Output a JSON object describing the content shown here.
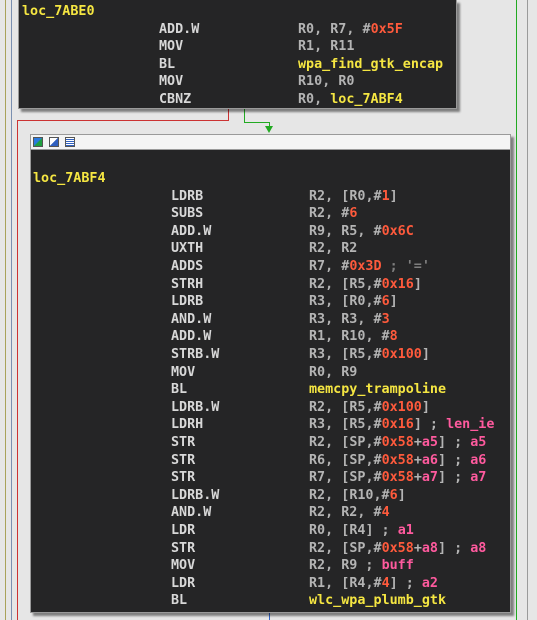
{
  "colors": {
    "background": "#e6e6e6",
    "node_bg": "#252526",
    "label": "#f5e642",
    "mnemonic": "#d8d8d8",
    "register": "#b4b4b4",
    "number": "#ff5a3c",
    "comment": "#7f7f7f",
    "variable": "#ff5a9e",
    "edge_true": "#22aa22",
    "edge_false": "#cc3333",
    "edge_normal": "#3366cc"
  },
  "node_a": {
    "label": "loc_7ABE0",
    "lines": [
      {
        "mn": "ADD.W",
        "ops": [
          {
            "t": "R0",
            "c": "reg"
          },
          {
            "t": ", ",
            "c": "plain"
          },
          {
            "t": "R7",
            "c": "reg"
          },
          {
            "t": ", #",
            "c": "plain"
          },
          {
            "t": "0x5F",
            "c": "num"
          }
        ]
      },
      {
        "mn": "MOV",
        "ops": [
          {
            "t": "R1",
            "c": "reg"
          },
          {
            "t": ", ",
            "c": "plain"
          },
          {
            "t": "R11",
            "c": "reg"
          }
        ]
      },
      {
        "mn": "BL",
        "ops": [
          {
            "t": "wpa_find_gtk_encap",
            "c": "sym"
          }
        ]
      },
      {
        "mn": "MOV",
        "ops": [
          {
            "t": "R10",
            "c": "reg"
          },
          {
            "t": ", ",
            "c": "plain"
          },
          {
            "t": "R0",
            "c": "reg"
          }
        ]
      },
      {
        "mn": "CBNZ",
        "ops": [
          {
            "t": "R0",
            "c": "reg"
          },
          {
            "t": ", ",
            "c": "plain"
          },
          {
            "t": "loc_7ABF4",
            "c": "sym"
          }
        ]
      }
    ]
  },
  "node_b": {
    "titlebar_icons": [
      "graph-color-icon",
      "graph-edit-icon",
      "graph-list-icon"
    ],
    "label": "loc_7ABF4",
    "lines": [
      {
        "mn": "LDRB",
        "ops": [
          {
            "t": "R2",
            "c": "reg"
          },
          {
            "t": ", [",
            "c": "plain"
          },
          {
            "t": "R0",
            "c": "reg"
          },
          {
            "t": ",#",
            "c": "plain"
          },
          {
            "t": "1",
            "c": "num"
          },
          {
            "t": "]",
            "c": "plain"
          }
        ]
      },
      {
        "mn": "SUBS",
        "ops": [
          {
            "t": "R2",
            "c": "reg"
          },
          {
            "t": ", #",
            "c": "plain"
          },
          {
            "t": "6",
            "c": "num"
          }
        ]
      },
      {
        "mn": "ADD.W",
        "ops": [
          {
            "t": "R9",
            "c": "reg"
          },
          {
            "t": ", ",
            "c": "plain"
          },
          {
            "t": "R5",
            "c": "reg"
          },
          {
            "t": ", #",
            "c": "plain"
          },
          {
            "t": "0x6C",
            "c": "num"
          }
        ]
      },
      {
        "mn": "UXTH",
        "ops": [
          {
            "t": "R2",
            "c": "reg"
          },
          {
            "t": ", ",
            "c": "plain"
          },
          {
            "t": "R2",
            "c": "reg"
          }
        ]
      },
      {
        "mn": "ADDS",
        "ops": [
          {
            "t": "R7",
            "c": "reg"
          },
          {
            "t": ", #",
            "c": "plain"
          },
          {
            "t": "0x3D",
            "c": "num"
          },
          {
            "t": " ; '='",
            "c": "cmt"
          }
        ]
      },
      {
        "mn": "STRH",
        "ops": [
          {
            "t": "R2",
            "c": "reg"
          },
          {
            "t": ", [",
            "c": "plain"
          },
          {
            "t": "R5",
            "c": "reg"
          },
          {
            "t": ",#",
            "c": "plain"
          },
          {
            "t": "0x16",
            "c": "num"
          },
          {
            "t": "]",
            "c": "plain"
          }
        ]
      },
      {
        "mn": "LDRB",
        "ops": [
          {
            "t": "R3",
            "c": "reg"
          },
          {
            "t": ", [",
            "c": "plain"
          },
          {
            "t": "R0",
            "c": "reg"
          },
          {
            "t": ",#",
            "c": "plain"
          },
          {
            "t": "6",
            "c": "num"
          },
          {
            "t": "]",
            "c": "plain"
          }
        ]
      },
      {
        "mn": "AND.W",
        "ops": [
          {
            "t": "R3",
            "c": "reg"
          },
          {
            "t": ", ",
            "c": "plain"
          },
          {
            "t": "R3",
            "c": "reg"
          },
          {
            "t": ", #",
            "c": "plain"
          },
          {
            "t": "3",
            "c": "num"
          }
        ]
      },
      {
        "mn": "ADD.W",
        "ops": [
          {
            "t": "R1",
            "c": "reg"
          },
          {
            "t": ", ",
            "c": "plain"
          },
          {
            "t": "R10",
            "c": "reg"
          },
          {
            "t": ", #",
            "c": "plain"
          },
          {
            "t": "8",
            "c": "num"
          }
        ]
      },
      {
        "mn": "STRB.W",
        "ops": [
          {
            "t": "R3",
            "c": "reg"
          },
          {
            "t": ", [",
            "c": "plain"
          },
          {
            "t": "R5",
            "c": "reg"
          },
          {
            "t": ",#",
            "c": "plain"
          },
          {
            "t": "0x100",
            "c": "num"
          },
          {
            "t": "]",
            "c": "plain"
          }
        ]
      },
      {
        "mn": "MOV",
        "ops": [
          {
            "t": "R0",
            "c": "reg"
          },
          {
            "t": ", ",
            "c": "plain"
          },
          {
            "t": "R9",
            "c": "reg"
          }
        ]
      },
      {
        "mn": "BL",
        "ops": [
          {
            "t": "memcpy_trampoline",
            "c": "sym"
          }
        ]
      },
      {
        "mn": "LDRB.W",
        "ops": [
          {
            "t": "R2",
            "c": "reg"
          },
          {
            "t": ", [",
            "c": "plain"
          },
          {
            "t": "R5",
            "c": "reg"
          },
          {
            "t": ",#",
            "c": "plain"
          },
          {
            "t": "0x100",
            "c": "num"
          },
          {
            "t": "]",
            "c": "plain"
          }
        ]
      },
      {
        "mn": "LDRH",
        "ops": [
          {
            "t": "R3",
            "c": "reg"
          },
          {
            "t": ", [",
            "c": "plain"
          },
          {
            "t": "R5",
            "c": "reg"
          },
          {
            "t": ",#",
            "c": "plain"
          },
          {
            "t": "0x16",
            "c": "num"
          },
          {
            "t": "] ; ",
            "c": "plain"
          },
          {
            "t": "len_ie",
            "c": "var"
          }
        ]
      },
      {
        "mn": "STR",
        "ops": [
          {
            "t": "R2",
            "c": "reg"
          },
          {
            "t": ", [",
            "c": "plain"
          },
          {
            "t": "SP",
            "c": "reg"
          },
          {
            "t": ",#",
            "c": "plain"
          },
          {
            "t": "0x58",
            "c": "num"
          },
          {
            "t": "+",
            "c": "plain"
          },
          {
            "t": "a5",
            "c": "var"
          },
          {
            "t": "] ; ",
            "c": "plain"
          },
          {
            "t": "a5",
            "c": "var"
          }
        ]
      },
      {
        "mn": "STR",
        "ops": [
          {
            "t": "R6",
            "c": "reg"
          },
          {
            "t": ", [",
            "c": "plain"
          },
          {
            "t": "SP",
            "c": "reg"
          },
          {
            "t": ",#",
            "c": "plain"
          },
          {
            "t": "0x58",
            "c": "num"
          },
          {
            "t": "+",
            "c": "plain"
          },
          {
            "t": "a6",
            "c": "var"
          },
          {
            "t": "] ; ",
            "c": "plain"
          },
          {
            "t": "a6",
            "c": "var"
          }
        ]
      },
      {
        "mn": "STR",
        "ops": [
          {
            "t": "R7",
            "c": "reg"
          },
          {
            "t": ", [",
            "c": "plain"
          },
          {
            "t": "SP",
            "c": "reg"
          },
          {
            "t": ",#",
            "c": "plain"
          },
          {
            "t": "0x58",
            "c": "num"
          },
          {
            "t": "+",
            "c": "plain"
          },
          {
            "t": "a7",
            "c": "var"
          },
          {
            "t": "] ; ",
            "c": "plain"
          },
          {
            "t": "a7",
            "c": "var"
          }
        ]
      },
      {
        "mn": "LDRB.W",
        "ops": [
          {
            "t": "R2",
            "c": "reg"
          },
          {
            "t": ", [",
            "c": "plain"
          },
          {
            "t": "R10",
            "c": "reg"
          },
          {
            "t": ",#",
            "c": "plain"
          },
          {
            "t": "6",
            "c": "num"
          },
          {
            "t": "]",
            "c": "plain"
          }
        ]
      },
      {
        "mn": "AND.W",
        "ops": [
          {
            "t": "R2",
            "c": "reg"
          },
          {
            "t": ", ",
            "c": "plain"
          },
          {
            "t": "R2",
            "c": "reg"
          },
          {
            "t": ", #",
            "c": "plain"
          },
          {
            "t": "4",
            "c": "num"
          }
        ]
      },
      {
        "mn": "LDR",
        "ops": [
          {
            "t": "R0",
            "c": "reg"
          },
          {
            "t": ", [",
            "c": "plain"
          },
          {
            "t": "R4",
            "c": "reg"
          },
          {
            "t": "] ; ",
            "c": "plain"
          },
          {
            "t": "a1",
            "c": "var"
          }
        ]
      },
      {
        "mn": "STR",
        "ops": [
          {
            "t": "R2",
            "c": "reg"
          },
          {
            "t": ", [",
            "c": "plain"
          },
          {
            "t": "SP",
            "c": "reg"
          },
          {
            "t": ",#",
            "c": "plain"
          },
          {
            "t": "0x58",
            "c": "num"
          },
          {
            "t": "+",
            "c": "plain"
          },
          {
            "t": "a8",
            "c": "var"
          },
          {
            "t": "] ; ",
            "c": "plain"
          },
          {
            "t": "a8",
            "c": "var"
          }
        ]
      },
      {
        "mn": "MOV",
        "ops": [
          {
            "t": "R2",
            "c": "reg"
          },
          {
            "t": ", ",
            "c": "plain"
          },
          {
            "t": "R9",
            "c": "reg"
          },
          {
            "t": " ; ",
            "c": "plain"
          },
          {
            "t": "buff",
            "c": "var"
          }
        ]
      },
      {
        "mn": "LDR",
        "ops": [
          {
            "t": "R1",
            "c": "reg"
          },
          {
            "t": ", [",
            "c": "plain"
          },
          {
            "t": "R4",
            "c": "reg"
          },
          {
            "t": ",#",
            "c": "plain"
          },
          {
            "t": "4",
            "c": "num"
          },
          {
            "t": "] ; ",
            "c": "plain"
          },
          {
            "t": "a2",
            "c": "var"
          }
        ]
      },
      {
        "mn": "BL",
        "ops": [
          {
            "t": "wlc_wpa_plumb_gtk",
            "c": "sym"
          }
        ]
      }
    ]
  }
}
